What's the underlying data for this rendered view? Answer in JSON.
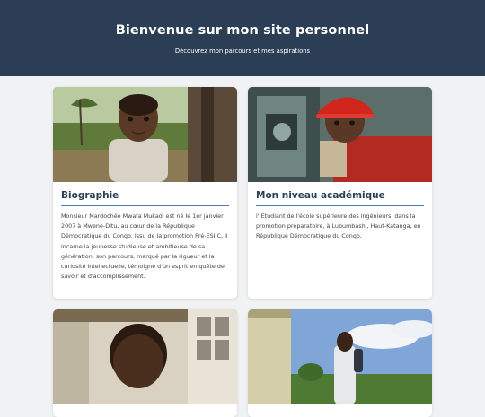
{
  "header": {
    "title": "Bienvenue sur mon site personnel",
    "subtitle": "Découvrez mon parcours et mes aspirations"
  },
  "cards": [
    {
      "title": "Biographie",
      "text": "Monsieur Mardochée Mwata Mukadi est né le 1er janvier 2007 à Mwene-Ditu, au cœur de la République Démocratique du Congo. Issu de la promotion Pré-ESI C, il incarne la jeunesse studieuse et ambitieuse de sa génération. son parcours, marqué par la rigueur et la curiosité intellectuelle, témoigne d'un esprit en quête de savoir et d'accomplissement.",
      "image": "photo-child-outdoors"
    },
    {
      "title": "Mon niveau académique",
      "text": "l' Etudiant de l'école supérieure des ingénieurs, dans la promotion préparatoire, à Lubumbashi, Haut-Katanga, en République Démocratique du Congo.",
      "image": "photo-student-red-helmet"
    },
    {
      "image": "photo-portrait-building"
    },
    {
      "image": "photo-student-outdoors-sky"
    }
  ]
}
